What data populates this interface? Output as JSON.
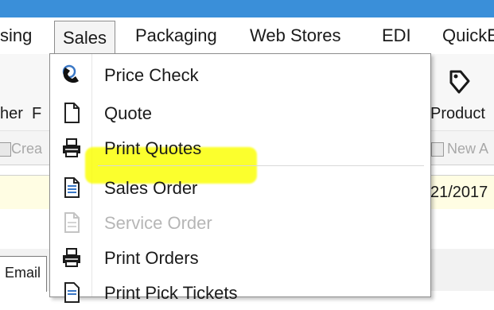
{
  "menubar": {
    "items": [
      {
        "id": "purchasing",
        "label": "sing"
      },
      {
        "id": "sales",
        "label": "Sales"
      },
      {
        "id": "packaging",
        "label": "Packaging"
      },
      {
        "id": "web_stores",
        "label": "Web Stores"
      },
      {
        "id": "edi",
        "label": "EDI"
      },
      {
        "id": "quickbooks",
        "label": "QuickE"
      }
    ],
    "active": "Sales"
  },
  "background": {
    "ribbon_left_label": "her",
    "ribbon_left_label2": "F",
    "ribbon_product_label": "Product",
    "toolbar_create_label": "Crea",
    "toolbar_new_label": "New A",
    "date_value": "21/2017",
    "tab_email_label": "Email"
  },
  "sales_menu": {
    "items": [
      {
        "label": "Price Check",
        "icon": "price-check-icon",
        "enabled": true
      },
      {
        "label": "Quote",
        "icon": "document-icon",
        "enabled": true,
        "highlighted": true
      },
      {
        "label": "Print Quotes",
        "icon": "printer-icon",
        "enabled": true
      },
      {
        "label": "Sales Order",
        "icon": "document-lines-icon",
        "enabled": true
      },
      {
        "label": "Service Order",
        "icon": "document-icon",
        "enabled": false
      },
      {
        "label": "Print Orders",
        "icon": "printer-icon",
        "enabled": true
      },
      {
        "label": "Print Pick Tickets",
        "icon": "document-lines-icon",
        "enabled": true
      }
    ]
  },
  "colors": {
    "titlebar": "#3a8fd9",
    "highlight": "#fbff00",
    "disabled_text": "#b6b6b6"
  }
}
